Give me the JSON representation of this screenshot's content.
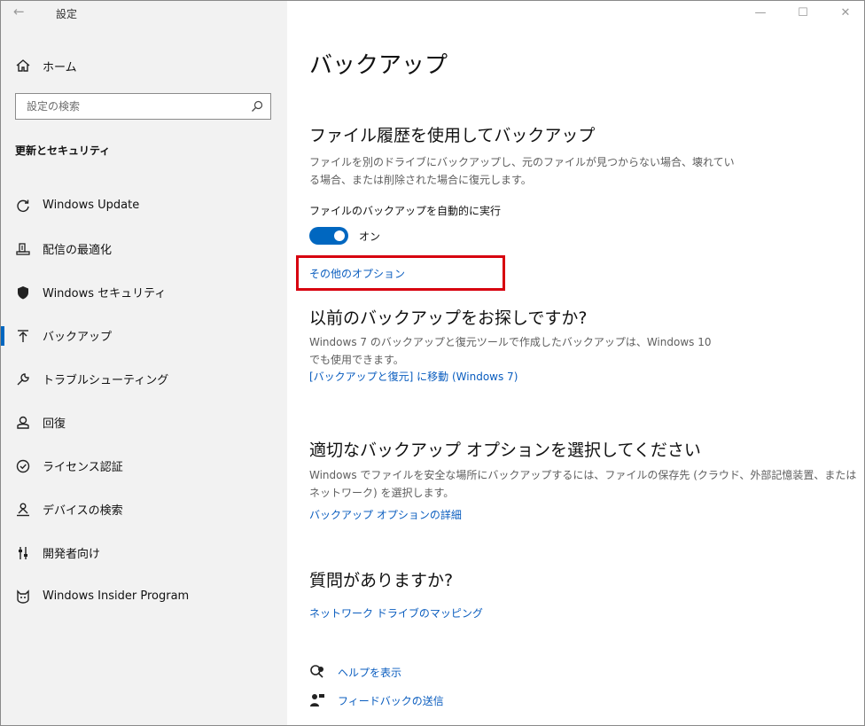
{
  "window": {
    "back_glyph": "←",
    "title": "設定",
    "controls": {
      "minimize": "—",
      "maximize": "☐",
      "close": "✕"
    }
  },
  "sidebar": {
    "home_label": "ホーム",
    "search_placeholder": "設定の検索",
    "section_label": "更新とセキュリティ",
    "items": [
      {
        "label": "Windows Update",
        "icon": "sync-icon"
      },
      {
        "label": "配信の最適化",
        "icon": "delivery-optimization-icon"
      },
      {
        "label": "Windows セキュリティ",
        "icon": "shield-icon"
      },
      {
        "label": "バックアップ",
        "icon": "backup-upload-icon",
        "active": true
      },
      {
        "label": "トラブルシューティング",
        "icon": "wrench-icon"
      },
      {
        "label": "回復",
        "icon": "recovery-icon"
      },
      {
        "label": "ライセンス認証",
        "icon": "check-circle-icon"
      },
      {
        "label": "デバイスの検索",
        "icon": "person-location-icon"
      },
      {
        "label": "開発者向け",
        "icon": "developer-sliders-icon"
      },
      {
        "label": "Windows Insider Program",
        "icon": "insider-cat-icon"
      }
    ]
  },
  "main": {
    "title": "バックアップ",
    "file_history": {
      "heading": "ファイル履歴を使用してバックアップ",
      "desc_line1": "ファイルを別のドライブにバックアップし、元のファイルが見つからない場合、壊れてい",
      "desc_line2": "る場合、または削除された場合に復元します。",
      "auto_label": "ファイルのバックアップを自動的に実行",
      "toggle_state": "オン",
      "more_options_link": "その他のオプション"
    },
    "older_backup": {
      "heading": "以前のバックアップをお探しですか?",
      "desc_line1": "Windows 7 のバックアップと復元ツールで作成したバックアップは、Windows 10",
      "desc_line2": "でも使用できます。",
      "link": "[バックアップと復元] に移動 (Windows 7)"
    },
    "choose_option": {
      "heading": "適切なバックアップ オプションを選択してください",
      "desc_line1": "Windows でファイルを安全な場所にバックアップするには、ファイルの保存先 (クラウド、外部記憶装置、または",
      "desc_line2": "ネットワーク) を選択します。",
      "link": "バックアップ オプションの詳細"
    },
    "questions": {
      "heading": "質問がありますか?",
      "link": "ネットワーク ドライブのマッピング"
    },
    "help": {
      "get_help": "ヘルプを表示",
      "feedback": "フィードバックの送信"
    }
  },
  "colors": {
    "accent": "#0067c0",
    "link": "#0a5dbf",
    "highlight_border": "#d7000f",
    "sidebar_bg": "#f2f2f2"
  }
}
